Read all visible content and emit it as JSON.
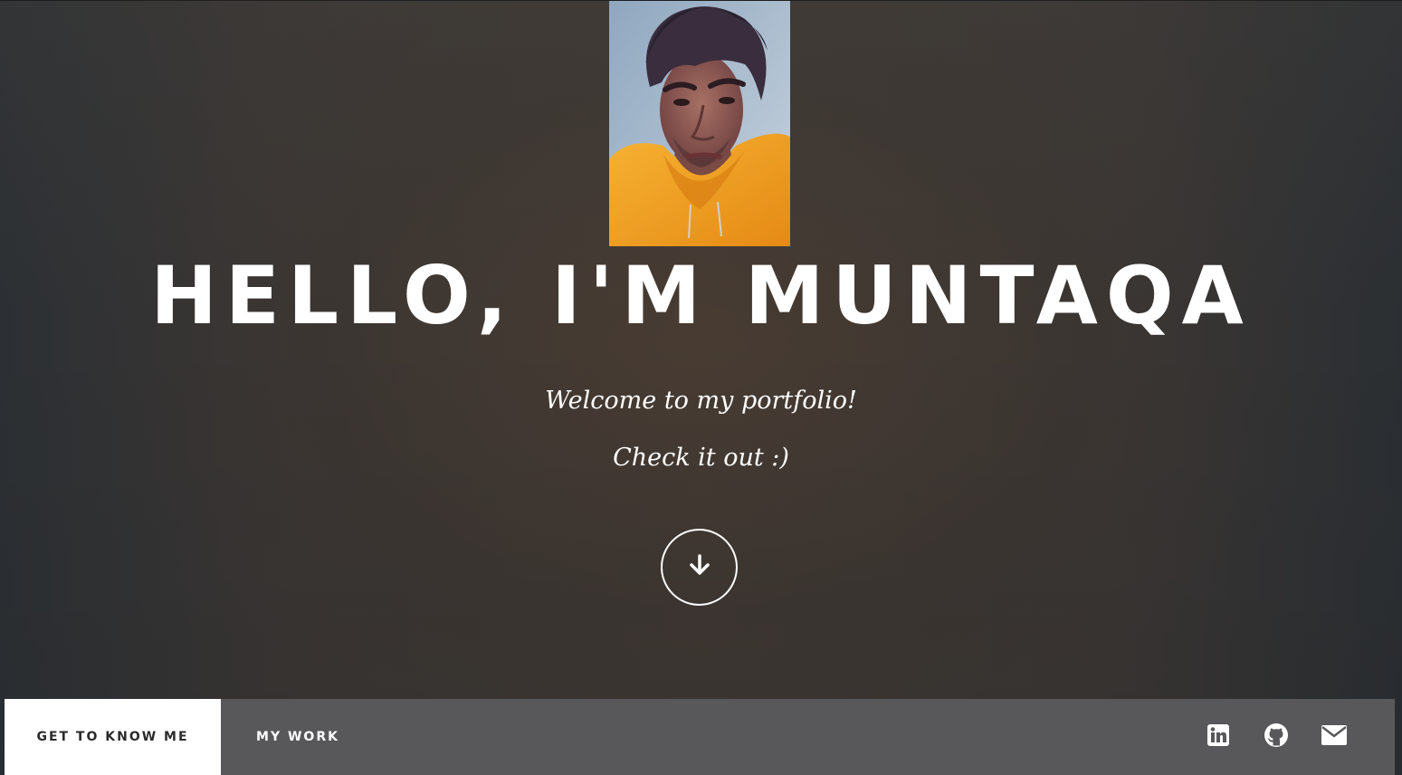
{
  "hero": {
    "headline": "HELLO, I'M MUNTAQA",
    "subtitle_line1": "Welcome to my portfolio!",
    "subtitle_line2": "Check it out :)",
    "scroll_icon": "arrow-down-icon",
    "portrait_alt": "profile-photo"
  },
  "nav": {
    "items": [
      {
        "label": "GET TO KNOW ME",
        "active": true
      },
      {
        "label": "MY WORK",
        "active": false
      }
    ],
    "social": [
      {
        "icon": "linkedin-icon"
      },
      {
        "icon": "github-icon"
      },
      {
        "icon": "email-icon"
      }
    ]
  },
  "colors": {
    "nav_background": "#58585a",
    "nav_active_background": "#ffffff",
    "text": "#ffffff",
    "hoodie": "#f2a01e"
  }
}
